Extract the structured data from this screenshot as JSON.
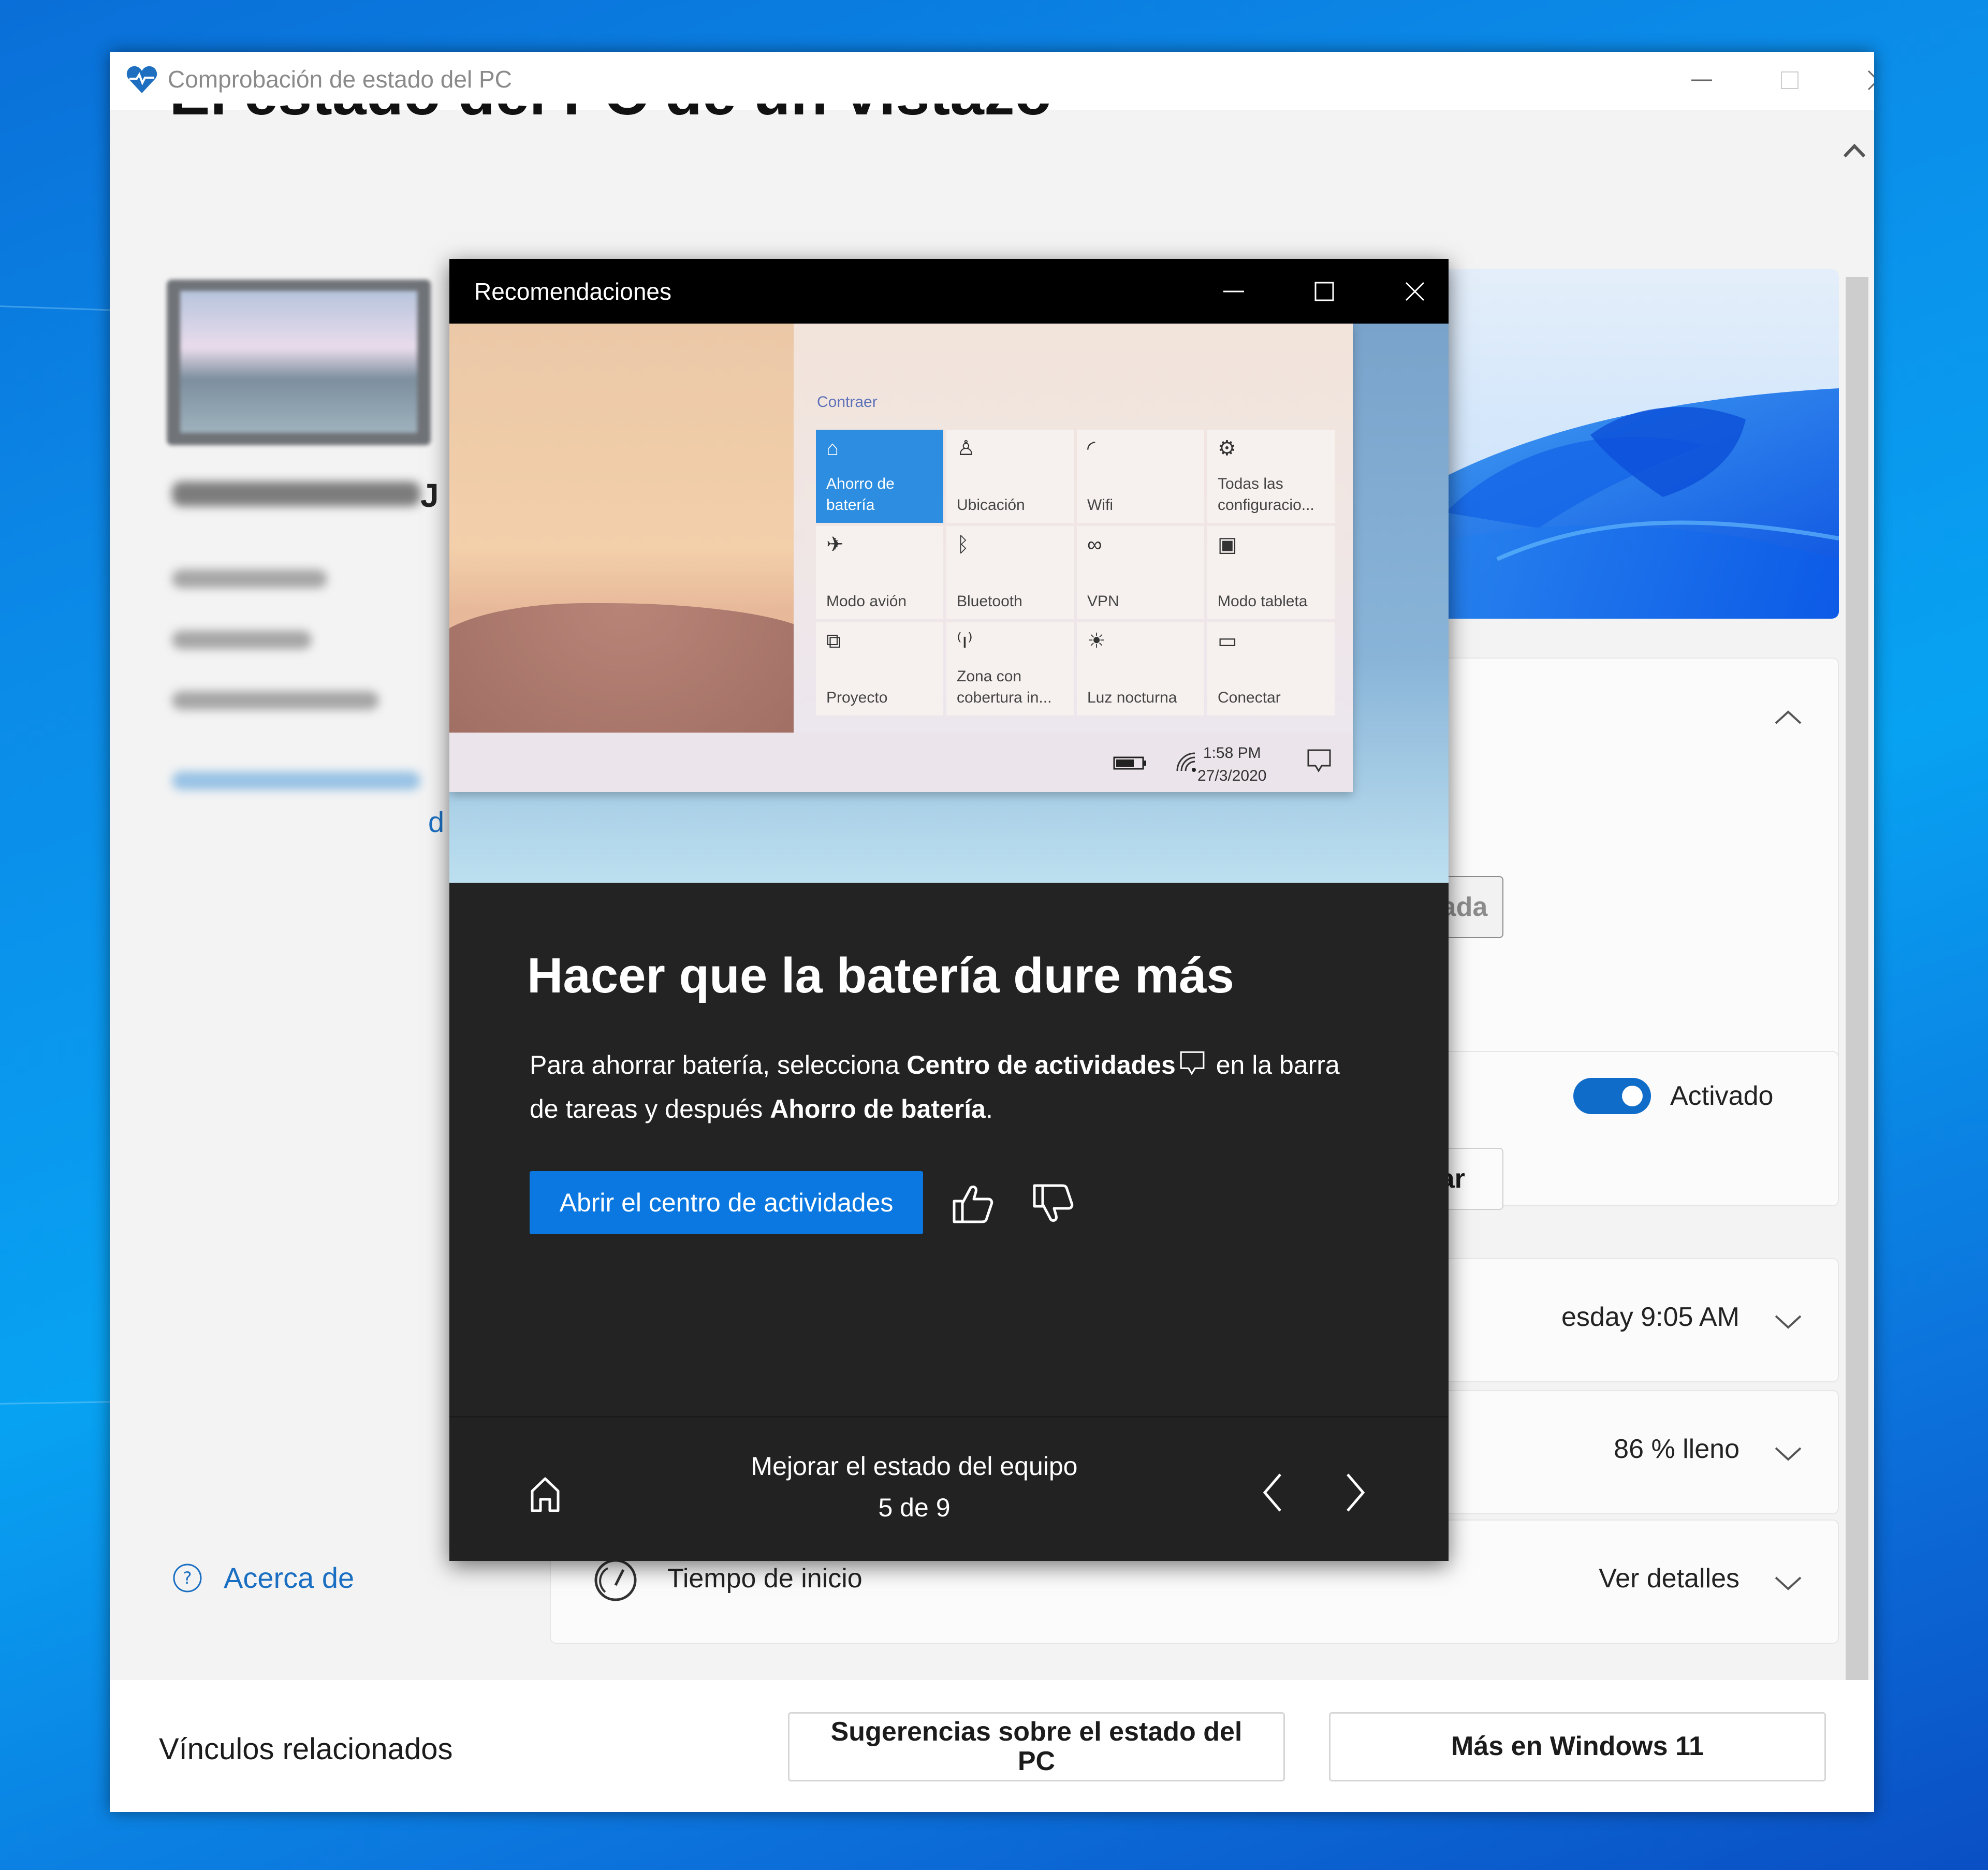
{
  "window": {
    "title": "Comprobación de estado del PC",
    "controls": {
      "minimize": "minimize",
      "maximize": "maximize",
      "close": "close"
    }
  },
  "page": {
    "title": "El estado del PC de un vistazo",
    "device_name_visible_tail": "J",
    "rename_link_visible_tail": "d",
    "about_link": "Acerca de"
  },
  "cards": {
    "session_button": "Sesión iniciada",
    "backup_toggle": {
      "state": "on",
      "label": "Activado"
    },
    "manage_button": "Administrar",
    "update_row": {
      "value": "esday 9:05 AM"
    },
    "storage_row": {
      "value": "86 % lleno"
    },
    "startup_row": {
      "label": "Tiempo de inicio",
      "value": "Ver detalles"
    }
  },
  "related": {
    "label": "Vínculos relacionados",
    "buttons": [
      "Sugerencias sobre el estado del PC",
      "Más en Windows 11"
    ]
  },
  "dialog": {
    "title": "Recomendaciones",
    "mock": {
      "collapse": "Contraer",
      "tiles": [
        {
          "icon": "battery-saver-icon",
          "glyph": "⌂",
          "label": "Ahorro de batería",
          "active": true
        },
        {
          "icon": "location-icon",
          "glyph": "♙",
          "label": "Ubicación",
          "active": false
        },
        {
          "icon": "wifi-icon",
          "glyph": "◜",
          "label": "Wifi",
          "active": false
        },
        {
          "icon": "settings-icon",
          "glyph": "⚙",
          "label": "Todas las configuracio...",
          "active": false
        },
        {
          "icon": "airplane-icon",
          "glyph": "✈",
          "label": "Modo avión",
          "active": false
        },
        {
          "icon": "bluetooth-icon",
          "glyph": "ᛒ",
          "label": "Bluetooth",
          "active": false
        },
        {
          "icon": "vpn-icon",
          "glyph": "∞",
          "label": "VPN",
          "active": false
        },
        {
          "icon": "tablet-mode-icon",
          "glyph": "▣",
          "label": "Modo tableta",
          "active": false
        },
        {
          "icon": "project-icon",
          "glyph": "⧉",
          "label": "Proyecto",
          "active": false
        },
        {
          "icon": "hotspot-icon",
          "glyph": "⁽ı⁾",
          "label": "Zona con cobertura in...",
          "active": false
        },
        {
          "icon": "night-light-icon",
          "glyph": "☀",
          "label": "Luz nocturna",
          "active": false
        },
        {
          "icon": "connect-icon",
          "glyph": "▭",
          "label": "Conectar",
          "active": false
        }
      ],
      "taskbar_time": "1:58 PM",
      "taskbar_date": "27/3/2020"
    },
    "heading": "Hacer que la batería dure más",
    "body": {
      "part1": "Para ahorrar batería, selecciona ",
      "bold1": "Centro de actividades",
      "part2": " en la barra de tareas y después ",
      "bold2": "Ahorro de batería",
      "part3": "."
    },
    "primary_button": "Abrir el centro de actividades",
    "footer": {
      "title": "Mejorar el estado del equipo",
      "position": "5 de 9",
      "current": 5,
      "total": 9
    }
  },
  "colors": {
    "accent": "#0a78e0",
    "link": "#1a6fc2",
    "dialog_bg": "#232323",
    "toggle_on": "#0f6cc9"
  }
}
